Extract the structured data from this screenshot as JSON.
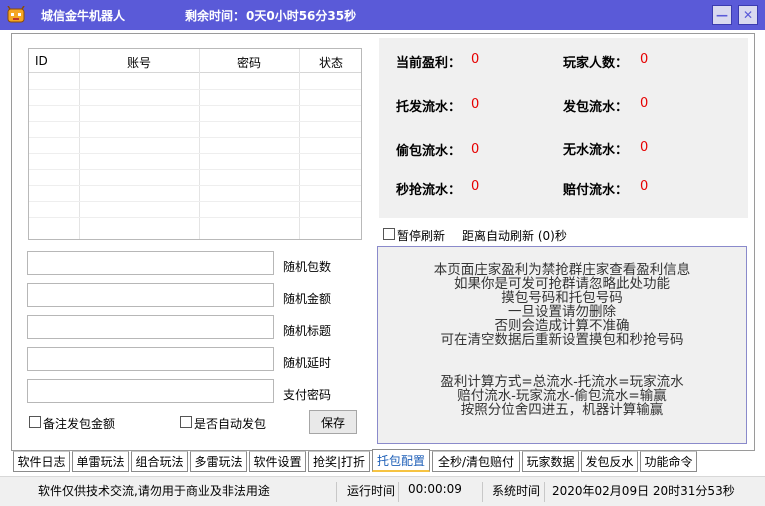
{
  "window": {
    "title": "城信金牛机器人",
    "remaining_label": "剩余时间：",
    "remaining_value": "0天0小时56分35秒",
    "minimize": "—",
    "close": "✕",
    "icon": "robot-app-icon"
  },
  "table": {
    "columns": [
      "ID",
      "账号",
      "密码",
      "状态"
    ],
    "rows": []
  },
  "inputs": [
    {
      "label": "随机包数",
      "value": ""
    },
    {
      "label": "随机金额",
      "value": ""
    },
    {
      "label": "随机标题",
      "value": ""
    },
    {
      "label": "随机延时",
      "value": ""
    },
    {
      "label": "支付密码",
      "value": ""
    }
  ],
  "options": {
    "note_amount": "备注发包金额",
    "auto_send": "是否自动发包",
    "save": "保存"
  },
  "stats": {
    "current_profit_label": "当前盈利：",
    "current_profit": "0",
    "player_count_label": "玩家人数：",
    "player_count": "0",
    "tuofa_label": "托发流水：",
    "tuofa": "0",
    "fabao_label": "发包流水：",
    "fabao": "0",
    "toubao_label": "偷包流水：",
    "toubao": "0",
    "wushui_label": "无水流水：",
    "wushui": "0",
    "miaoqiang_label": "秒抢流水：",
    "miaoqiang": "0",
    "peifu_label": "赔付流水：",
    "peifu": "0"
  },
  "refresh": {
    "pause_label": "暂停刷新",
    "auto_label": "距离自动刷新 (0)秒"
  },
  "info": {
    "lines": [
      "本页面庄家盈利为禁抢群庄家查看盈利信息",
      "如果你是可发可抢群请忽略此处功能",
      "摸包号码和托包号码",
      "一旦设置请勿删除",
      "否则会造成计算不准确",
      "可在清空数据后重新设置摸包和秒抢号码",
      "",
      "盈利计算方式=总流水-托流水=玩家流水",
      "赔付流水-玩家流水-偷包流水=输赢",
      "按照分位舍四进五，机器计算输赢"
    ]
  },
  "tabs": [
    "软件日志",
    "单雷玩法",
    "组合玩法",
    "多雷玩法",
    "软件设置",
    "抢奖|打折",
    "托包配置",
    "全秒/清包赔付",
    "玩家数据",
    "发包反水",
    "功能命令"
  ],
  "active_tab": "托包配置",
  "statusbar": {
    "notice": "软件仅供技术交流,请勿用于商业及非法用途",
    "run_label": "运行时间",
    "run_value": "00:00:09",
    "sys_label": "系统时间",
    "sys_value": "2020年02月09日 20时31分53秒"
  }
}
